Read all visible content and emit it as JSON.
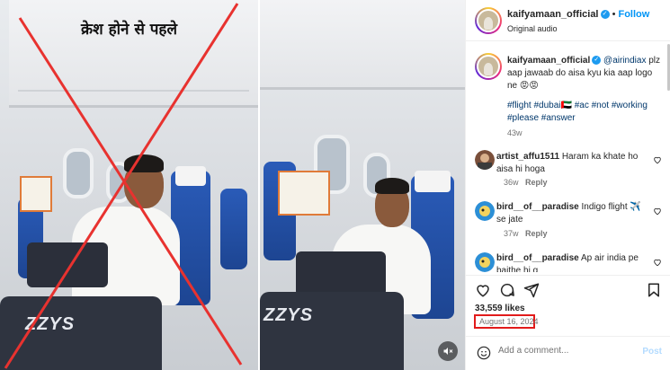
{
  "left_image": {
    "overlay_title": "क्रेश होने से पहले",
    "seat_brand_text": "ZZYS"
  },
  "right_image": {
    "seat_brand_text": "ZZYS"
  },
  "post": {
    "username": "kaifyamaan_official",
    "follow_label": "Follow",
    "audio": "Original audio",
    "caption": {
      "username": "kaifyamaan_official",
      "mention": "@airindiax",
      "text": "plz aap jawaab do aisa kyu kia aap logo ne 😡😡",
      "hashtags": "#flight #dubai🇦🇪 #ac #not #working #please #answer",
      "age": "43w"
    },
    "comments": [
      {
        "username": "artist_affu1511",
        "text": "Haram ka khate ho aisa hi hoga",
        "age": "36w",
        "reply_label": "Reply"
      },
      {
        "username": "bird__of__paradise",
        "text": "Indigo flight ✈️ se jate",
        "age": "37w",
        "reply_label": "Reply"
      },
      {
        "username": "bird__of__paradise",
        "text": "Ap air india pe baithe hi g",
        "age": "",
        "reply_label": ""
      }
    ],
    "likes": "33,559 likes",
    "date": "August 16, 2024",
    "comment_placeholder": "Add a comment...",
    "post_label": "Post"
  },
  "colors": {
    "cross_red": "#e8322f",
    "follow_blue": "#0095f6",
    "date_highlight": "#e21b1b",
    "seat_blue": "#2a5bb8"
  },
  "icons": [
    "verified-icon",
    "heart-icon",
    "comment-icon",
    "share-icon",
    "save-icon",
    "emoji-icon",
    "mute-icon"
  ]
}
